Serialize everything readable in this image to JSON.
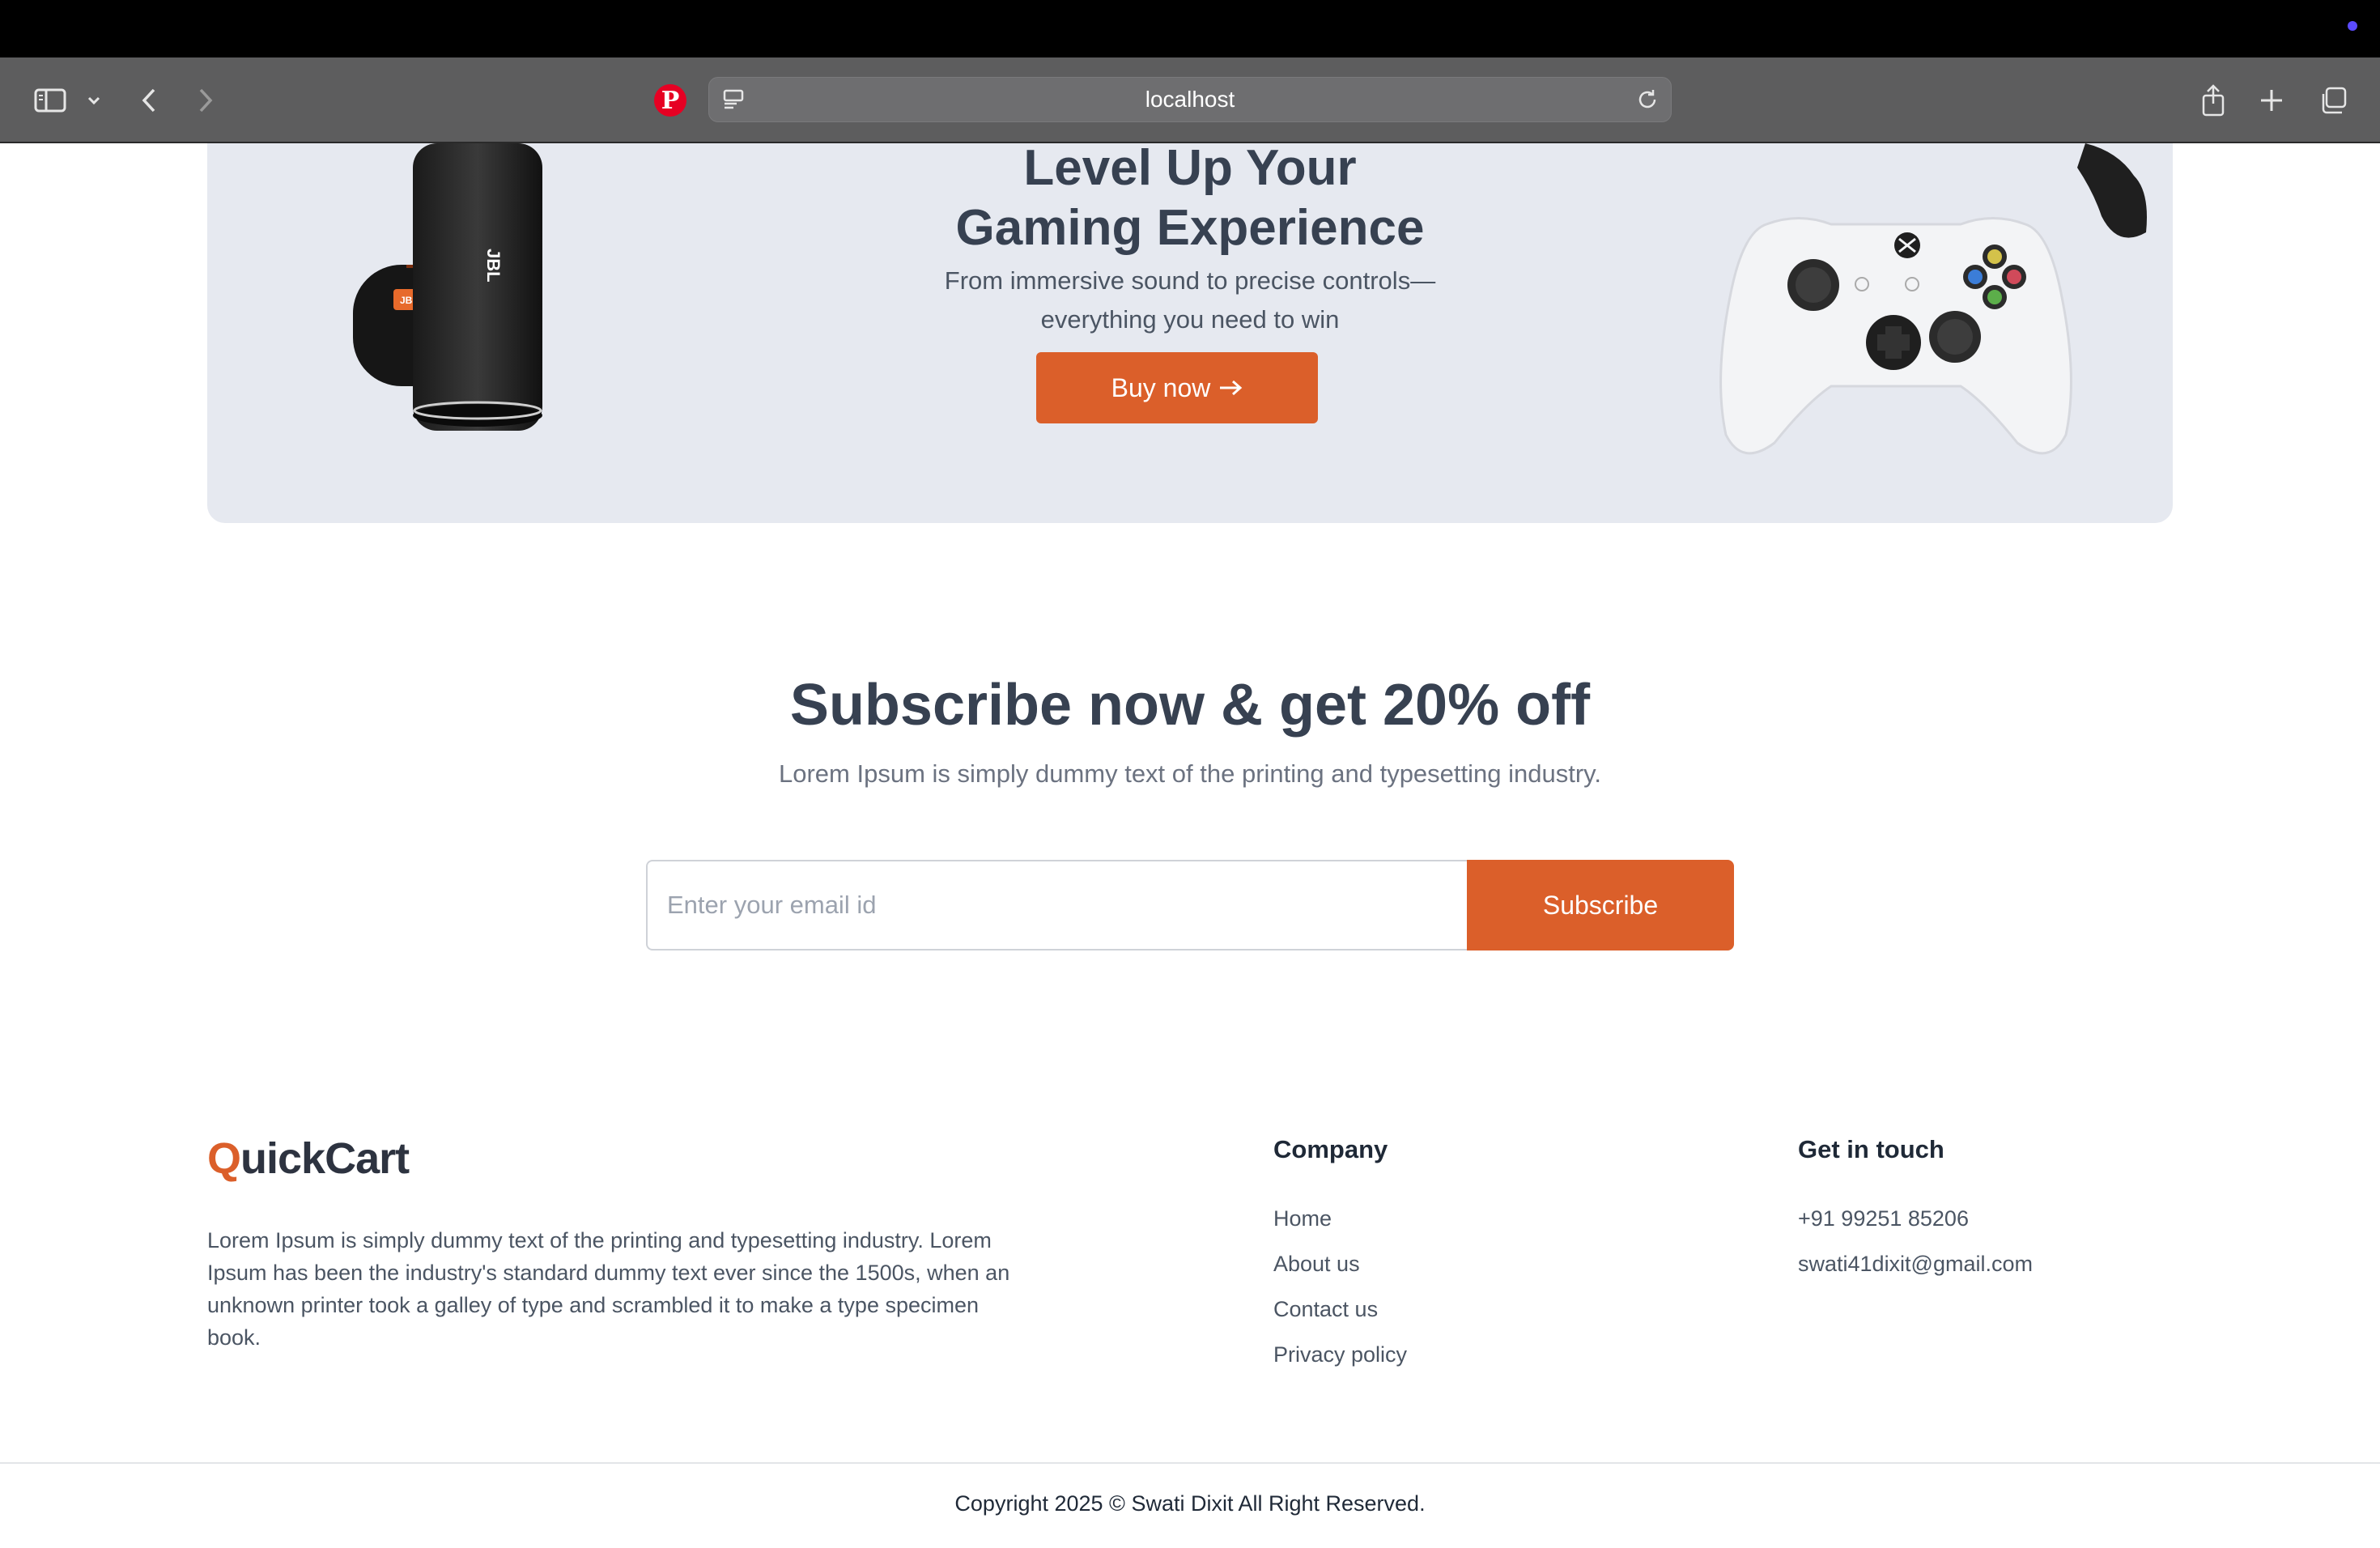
{
  "browser": {
    "url": "localhost"
  },
  "hero": {
    "title_line1": "Level Up Your",
    "title_line2": "Gaming Experience",
    "subtitle_line1": "From immersive sound to precise controls—",
    "subtitle_line2": "everything you need to win",
    "buy_label": "Buy now",
    "speaker_brand": "JBL"
  },
  "subscribe": {
    "title": "Subscribe now & get 20% off",
    "description": "Lorem Ipsum is simply dummy text of the printing and typesetting industry.",
    "email_placeholder": "Enter your email id",
    "button_label": "Subscribe"
  },
  "footer": {
    "logo_first": "Q",
    "logo_rest": "uickCart",
    "description": "Lorem Ipsum is simply dummy text of the printing and typesetting industry. Lorem Ipsum has been the industry's standard dummy text ever since the 1500s, when an unknown printer took a galley of type and scrambled it to make a type specimen book.",
    "company": {
      "heading": "Company",
      "links": [
        "Home",
        "About us",
        "Contact us",
        "Privacy policy"
      ]
    },
    "contact": {
      "heading": "Get in touch",
      "phone": "+91 99251 85206",
      "email": "swati41dixit@gmail.com"
    },
    "copyright": "Copyright 2025 © Swati Dixit All Right Reserved."
  },
  "colors": {
    "accent": "#db5f2a",
    "hero_bg": "#e6e9f0",
    "heading": "#374151"
  }
}
